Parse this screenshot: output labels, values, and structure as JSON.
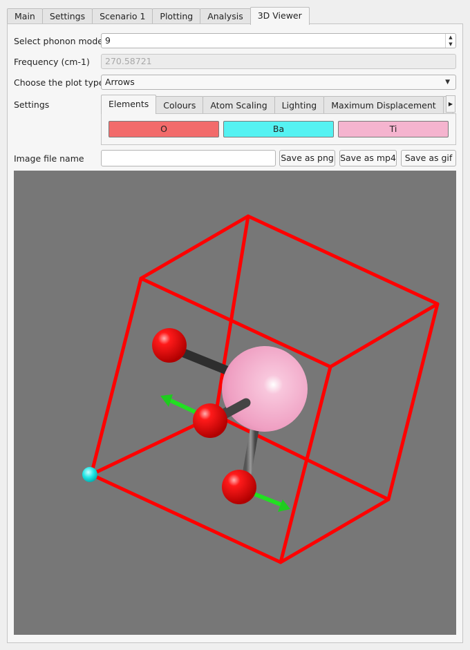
{
  "tabs": [
    "Main",
    "Settings",
    "Scenario 1",
    "Plotting",
    "Analysis",
    "3D Viewer"
  ],
  "active_tab": "3D Viewer",
  "phonon_mode": {
    "label": "Select phonon mode",
    "value": "9"
  },
  "frequency": {
    "label": "Frequency (cm-1)",
    "value": "270.58721"
  },
  "plot_type": {
    "label": "Choose the plot type",
    "value": "Arrows"
  },
  "settings": {
    "label": "Settings",
    "tabs": [
      "Elements",
      "Colours",
      "Atom Scaling",
      "Lighting",
      "Maximum Displacement"
    ],
    "active_tab": "Elements",
    "elements": [
      {
        "name": "O",
        "color": "#f26b6b"
      },
      {
        "name": "Ba",
        "color": "#55f2f2"
      },
      {
        "name": "Ti",
        "color": "#f5b4cf"
      }
    ]
  },
  "image_file": {
    "label": "Image file name",
    "value": "",
    "save_png": "Save as png",
    "save_mp4": "Save as mp4",
    "save_gif": "Save as gif"
  },
  "viewer": {
    "background": "#777777",
    "cell_color": "#ff0000",
    "bond_color": "#3a3a3a",
    "arrow_color": "#22e022"
  }
}
